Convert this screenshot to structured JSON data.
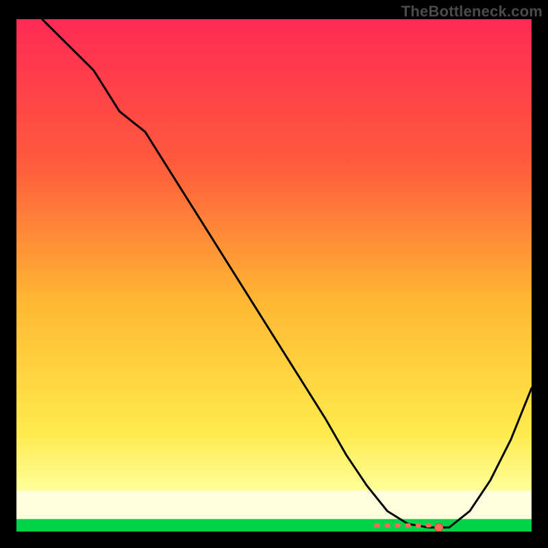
{
  "watermark": "TheBottleneck.com",
  "chart_data": {
    "type": "line",
    "title": "",
    "xlabel": "",
    "ylabel": "",
    "xlim": [
      0,
      100
    ],
    "ylim": [
      0,
      100
    ],
    "grid": false,
    "legend": false,
    "background_gradient": {
      "top": "#ff2a55",
      "mid": "#ffb733",
      "low": "#ffff66",
      "band": "#ffffe0",
      "bottom": "#00d24a"
    },
    "series": [
      {
        "name": "curve",
        "x": [
          5,
          10,
          15,
          20,
          25,
          30,
          35,
          40,
          45,
          50,
          55,
          60,
          64,
          68,
          72,
          76,
          80,
          84,
          88,
          92,
          96,
          100
        ],
        "y": [
          100,
          95,
          90,
          82,
          78,
          70,
          62,
          54,
          46,
          38,
          30,
          22,
          15,
          9,
          4,
          1.5,
          0.8,
          0.8,
          4,
          10,
          18,
          28
        ]
      }
    ],
    "marker": {
      "x": 82,
      "y": 0.8
    },
    "flat_cluster": {
      "x_start": 70,
      "x_end": 80,
      "y": 1.2
    }
  }
}
